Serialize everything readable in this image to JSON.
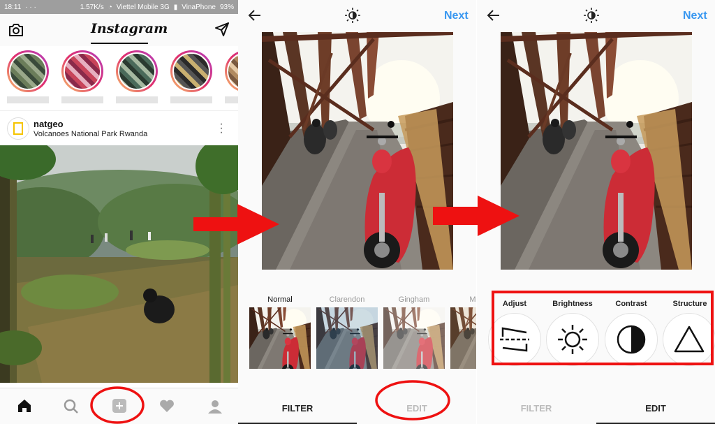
{
  "statusbar": {
    "time": "18:11",
    "speed": "1.57K/s",
    "carrier1": "Viettel Mobile 3G",
    "carrier2": "VinaPhone",
    "battery": "93%"
  },
  "feed": {
    "logo": "Instagram",
    "post": {
      "username": "natgeo",
      "location": "Volcanoes National Park Rwanda"
    },
    "icons": {
      "camera": "camera-icon",
      "direct": "paper-plane-icon",
      "more": "more-vertical-icon",
      "nav": [
        "home-icon",
        "search-icon",
        "add-icon",
        "heart-icon",
        "profile-icon"
      ]
    }
  },
  "filter_screen": {
    "next_label": "Next",
    "filters": [
      {
        "name": "Normal",
        "active": true
      },
      {
        "name": "Clarendon",
        "active": false
      },
      {
        "name": "Gingham",
        "active": false
      },
      {
        "name": "M",
        "active": false
      }
    ],
    "tabs": {
      "filter": "FILTER",
      "edit": "EDIT"
    },
    "active_tab": "FILTER"
  },
  "edit_screen": {
    "next_label": "Next",
    "tools": [
      {
        "name": "Adjust",
        "icon": "adjust-icon"
      },
      {
        "name": "Brightness",
        "icon": "brightness-icon"
      },
      {
        "name": "Contrast",
        "icon": "contrast-icon"
      },
      {
        "name": "Structure",
        "icon": "structure-icon"
      }
    ],
    "tabs": {
      "filter": "FILTER",
      "edit": "EDIT"
    },
    "active_tab": "EDIT"
  },
  "colors": {
    "accent_blue": "#3897f0",
    "annotation_red": "#ee1111",
    "status_bar": "#9e9e9e"
  }
}
